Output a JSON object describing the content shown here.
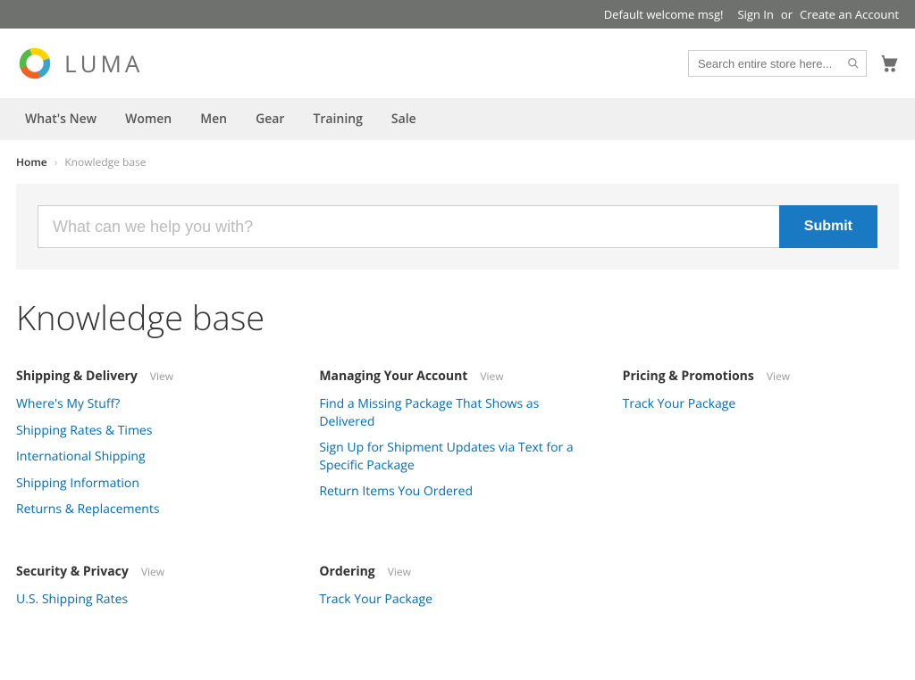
{
  "topbar": {
    "welcome": "Default welcome msg!",
    "sign_in": "Sign In",
    "or": "or",
    "create": "Create an Account"
  },
  "logo": {
    "word": "LUMA"
  },
  "header": {
    "search_placeholder": "Search entire store here..."
  },
  "nav": [
    "What's New",
    "Women",
    "Men",
    "Gear",
    "Training",
    "Sale"
  ],
  "breadcrumb": {
    "home": "Home",
    "current": "Knowledge base"
  },
  "kb_search": {
    "placeholder": "What can we help you with?",
    "submit": "Submit"
  },
  "page_title": "Knowledge base",
  "view_label": "View",
  "categories": [
    {
      "title": "Shipping & Delivery",
      "links": [
        "Where's My Stuff?",
        "Shipping Rates & Times",
        "International Shipping",
        "Shipping Information",
        "Returns & Replacements"
      ]
    },
    {
      "title": "Managing Your Account",
      "links": [
        "Find a Missing Package That Shows as Delivered",
        "Sign Up for Shipment Updates via Text for a Specific Package",
        "Return Items You Ordered"
      ]
    },
    {
      "title": "Pricing & Promotions",
      "links": [
        "Track Your Package"
      ]
    },
    {
      "title": "Security & Privacy",
      "links": [
        "U.S. Shipping Rates"
      ]
    },
    {
      "title": "Ordering",
      "links": [
        "Track Your Package"
      ]
    }
  ]
}
